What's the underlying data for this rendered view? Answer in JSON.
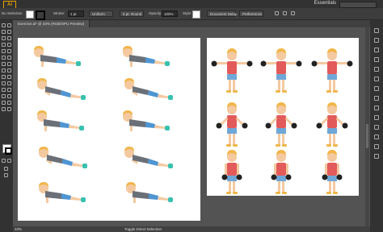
{
  "app": {
    "logo_text": "Ai",
    "workspace_label": "Essentials"
  },
  "control": {
    "selection_label": "No Selection",
    "stroke_label": "Stroke:",
    "stroke_value": "1 pt",
    "uniform_label": "Uniform",
    "brush_label": "5 pt. Round",
    "opacity_label": "Opacity:",
    "opacity_value": "100%",
    "style_label": "Style:",
    "document_setup_label": "Document Setup",
    "preferences_label": "Preferences"
  },
  "tabs": [
    {
      "label": "Exercise.ai* @ 33% (RGB/GPU Preview)"
    }
  ],
  "status": {
    "zoom": "33%",
    "text": "Toggle Direct Selection"
  },
  "colors": {
    "fill": "#ffffff",
    "stroke": "#000000",
    "hair": "#f0b64a",
    "skin": "#f4c9a0",
    "shirt_red": "#e35a5a",
    "shorts_blue": "#6fa7d8",
    "pushup_shirt": "#6b7078",
    "pushup_shorts": "#4f95d2",
    "shoes": "#38c1b0",
    "dumbbell": "#222222"
  }
}
